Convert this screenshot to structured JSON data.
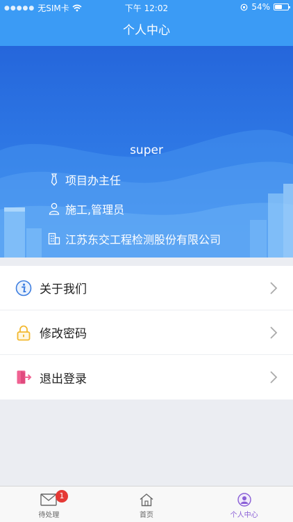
{
  "status_bar": {
    "carrier": "无SIM卡",
    "time": "下午 12:02",
    "battery_percent": "54%",
    "battery_level": 0.54
  },
  "nav": {
    "title": "个人中心"
  },
  "profile": {
    "username": "super",
    "position": "项目办主任",
    "role": "施工,管理员",
    "company": "江苏东交工程检测股份有限公司"
  },
  "menu": {
    "items": [
      {
        "label": "关于我们",
        "icon": "info-icon"
      },
      {
        "label": "修改密码",
        "icon": "lock-icon"
      },
      {
        "label": "退出登录",
        "icon": "logout-icon"
      }
    ]
  },
  "tabs": [
    {
      "label": "待处理",
      "icon": "mail-icon",
      "badge": "1"
    },
    {
      "label": "首页",
      "icon": "home-icon"
    },
    {
      "label": "个人中心",
      "icon": "user-icon",
      "active": true
    }
  ],
  "colors": {
    "header": "#3b9bf5",
    "hero_dark": "#2566db",
    "hero_light": "#3c8df0",
    "active_tab": "#8a5fd6",
    "badge": "#e53935"
  }
}
